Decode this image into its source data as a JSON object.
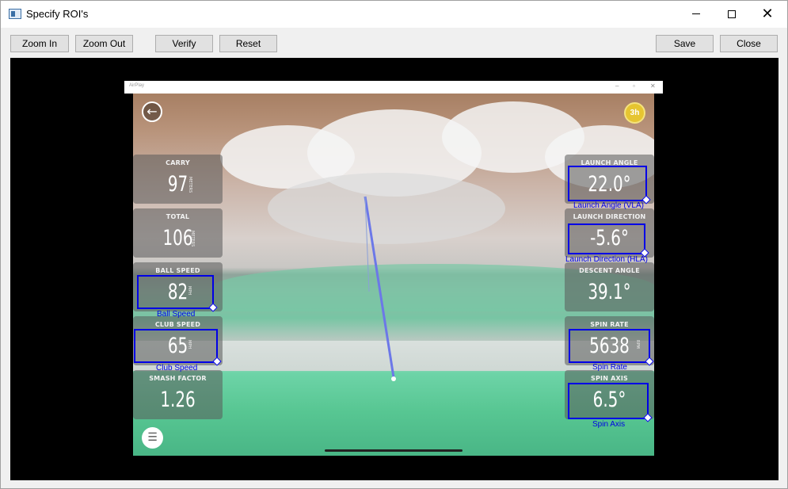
{
  "window": {
    "title": "Specify ROI's",
    "controls": {
      "minimize_icon": "minimize-icon",
      "maximize_icon": "maximize-icon",
      "close_icon": "close-icon",
      "close_glyph": "✕"
    }
  },
  "toolbar": {
    "zoom_in_label": "Zoom In",
    "zoom_out_label": "Zoom Out",
    "verify_label": "Verify",
    "reset_label": "Reset",
    "save_label": "Save",
    "close_label": "Close"
  },
  "inner_window": {
    "title": "AirPlay"
  },
  "game": {
    "badge_text": "3h",
    "panels_left": [
      {
        "label": "CARRY",
        "value": "97",
        "unit": "METERS"
      },
      {
        "label": "TOTAL",
        "value": "106",
        "unit": "METERS"
      },
      {
        "label": "BALL SPEED",
        "value": "82",
        "unit": "MPH"
      },
      {
        "label": "CLUB SPEED",
        "value": "65",
        "unit": "MPH"
      },
      {
        "label": "SMASH FACTOR",
        "value": "1.26",
        "unit": ""
      }
    ],
    "panels_right": [
      {
        "label": "LAUNCH ANGLE",
        "value": "22.0°",
        "unit": ""
      },
      {
        "label": "LAUNCH DIRECTION",
        "value": "-5.6°",
        "unit": ""
      },
      {
        "label": "DESCENT ANGLE",
        "value": "39.1°",
        "unit": ""
      },
      {
        "label": "SPIN RATE",
        "value": "5638",
        "unit": "RPM"
      },
      {
        "label": "SPIN AXIS",
        "value": "6.5°",
        "unit": ""
      }
    ]
  },
  "rois": {
    "ball_speed": "Ball Speed",
    "club_speed": "Club Speed",
    "launch_angle": "Launch Angle (VLA)",
    "launch_direction": "Launch Direction (HLA)",
    "spin_rate": "Spin Rate",
    "spin_axis": "Spin Axis"
  }
}
